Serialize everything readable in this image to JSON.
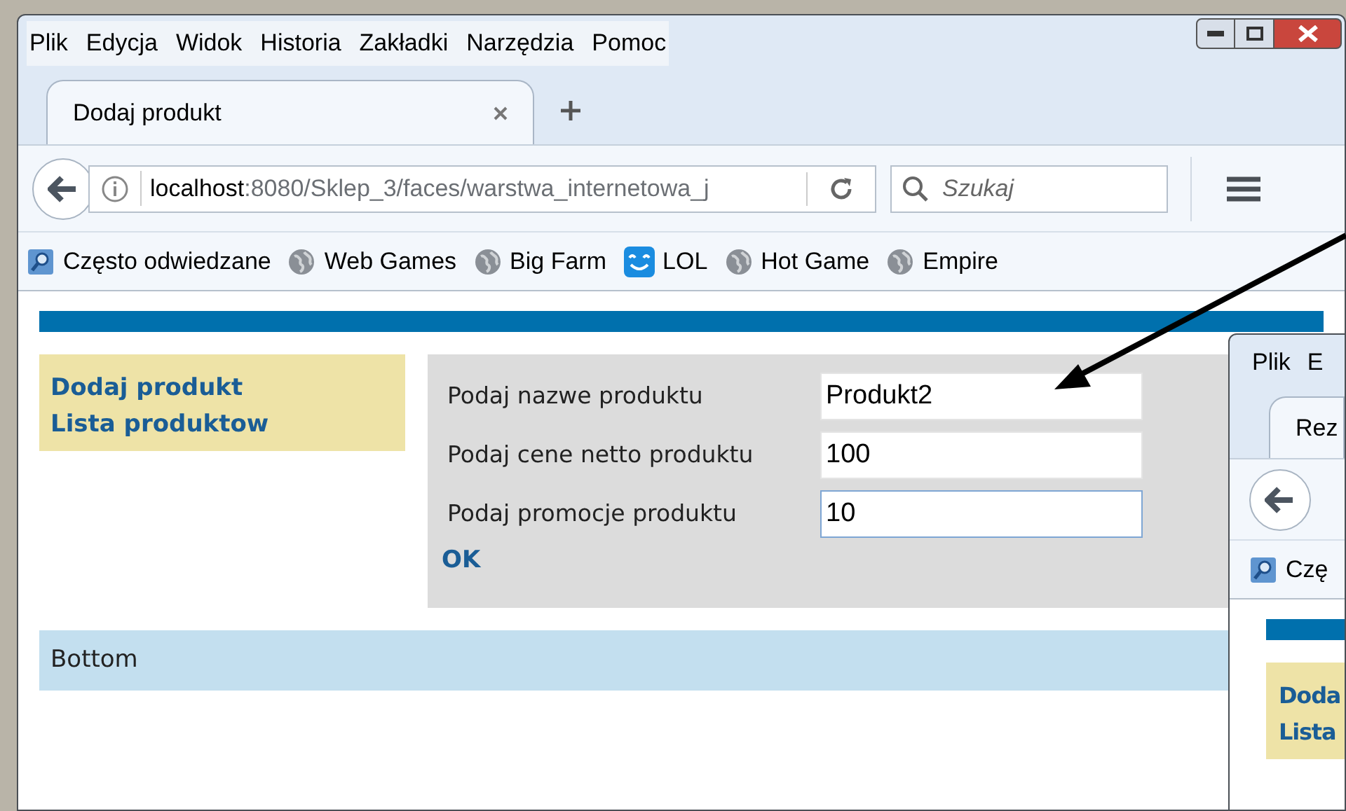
{
  "window": {
    "menu": [
      "Plik",
      "Edycja",
      "Widok",
      "Historia",
      "Zakładki",
      "Narzędzia",
      "Pomoc"
    ]
  },
  "tabs": [
    {
      "label": "Dodaj produkt",
      "selected": true
    }
  ],
  "address": {
    "host": "localhost",
    "path": ":8080/Sklep_3/faces/warstwa_internetowa_j"
  },
  "search": {
    "placeholder": "Szukaj"
  },
  "bookmarks": [
    {
      "label": "Często odwiedzane",
      "kind": "folder"
    },
    {
      "label": "Web Games",
      "kind": "globe"
    },
    {
      "label": "Big Farm",
      "kind": "globe"
    },
    {
      "label": "LOL",
      "kind": "smiley"
    },
    {
      "label": "Hot Game",
      "kind": "globe"
    },
    {
      "label": "Empire",
      "kind": "globe"
    }
  ],
  "page": {
    "nav": [
      "Dodaj produkt",
      "Lista produktow"
    ],
    "fields": [
      {
        "label": "Podaj nazwe produktu",
        "value": "Produkt2",
        "focused": false
      },
      {
        "label": "Podaj cene netto produktu",
        "value": "100",
        "focused": false
      },
      {
        "label": "Podaj promocje produktu",
        "value": "10",
        "focused": true
      }
    ],
    "submit": "OK",
    "footer": "Bottom"
  },
  "second_window": {
    "menu": [
      "Plik",
      "E"
    ],
    "tab": "Rez",
    "bookmark": "Czę",
    "nav": [
      "Doda",
      "Lista"
    ]
  }
}
